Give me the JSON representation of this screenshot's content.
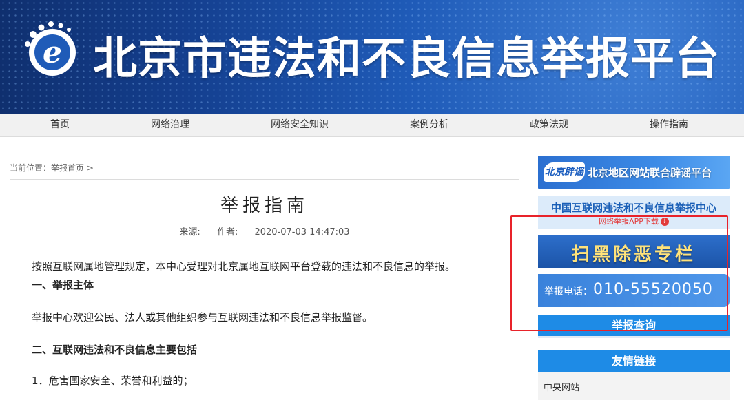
{
  "header": {
    "title": "北京市违法和不良信息举报平台"
  },
  "nav": {
    "items": [
      "首页",
      "网络治理",
      "网络安全知识",
      "案例分析",
      "政策法规",
      "操作指南"
    ]
  },
  "breadcrumb": {
    "prefix": "当前位置：",
    "link": "举报首页",
    "separator": ">"
  },
  "article": {
    "title": "举报指南",
    "meta": {
      "source_label": "来源:",
      "author_label": "作者:",
      "datetime": "2020-07-03 14:47:03"
    },
    "paragraphs": [
      "按照互联网属地管理规定，本中心受理对北京属地互联网平台登载的违法和不良信息的举报。",
      "一、举报主体",
      "举报中心欢迎公民、法人或其他组织参与互联网违法和不良信息举报监督。",
      "二、互联网违法和不良信息主要包括",
      "1．危害国家安全、荣誉和利益的；"
    ]
  },
  "sidebar": {
    "banner_rumor": {
      "logo": "北京辟谣",
      "text": "北京地区网站联合辟谣平台"
    },
    "banner_center": {
      "title": "中国互联网违法和不良信息举报中心",
      "sub": "网络举报APP下载"
    },
    "banner_special": {
      "text": "扫黑除恶专栏"
    },
    "banner_phone": {
      "label": "举报电话：",
      "number": "010-55520050"
    },
    "query_button": "举报查询",
    "links_header": "友情链接",
    "links": [
      "中央网站"
    ]
  },
  "colors": {
    "banner_blue": "#1f5bb8",
    "nav_bg": "#f1f1f1",
    "sidebar_button_blue": "#1e8be6",
    "highlight_box_red": "#e8232a",
    "special_text_yellow": "#ffe27a"
  }
}
